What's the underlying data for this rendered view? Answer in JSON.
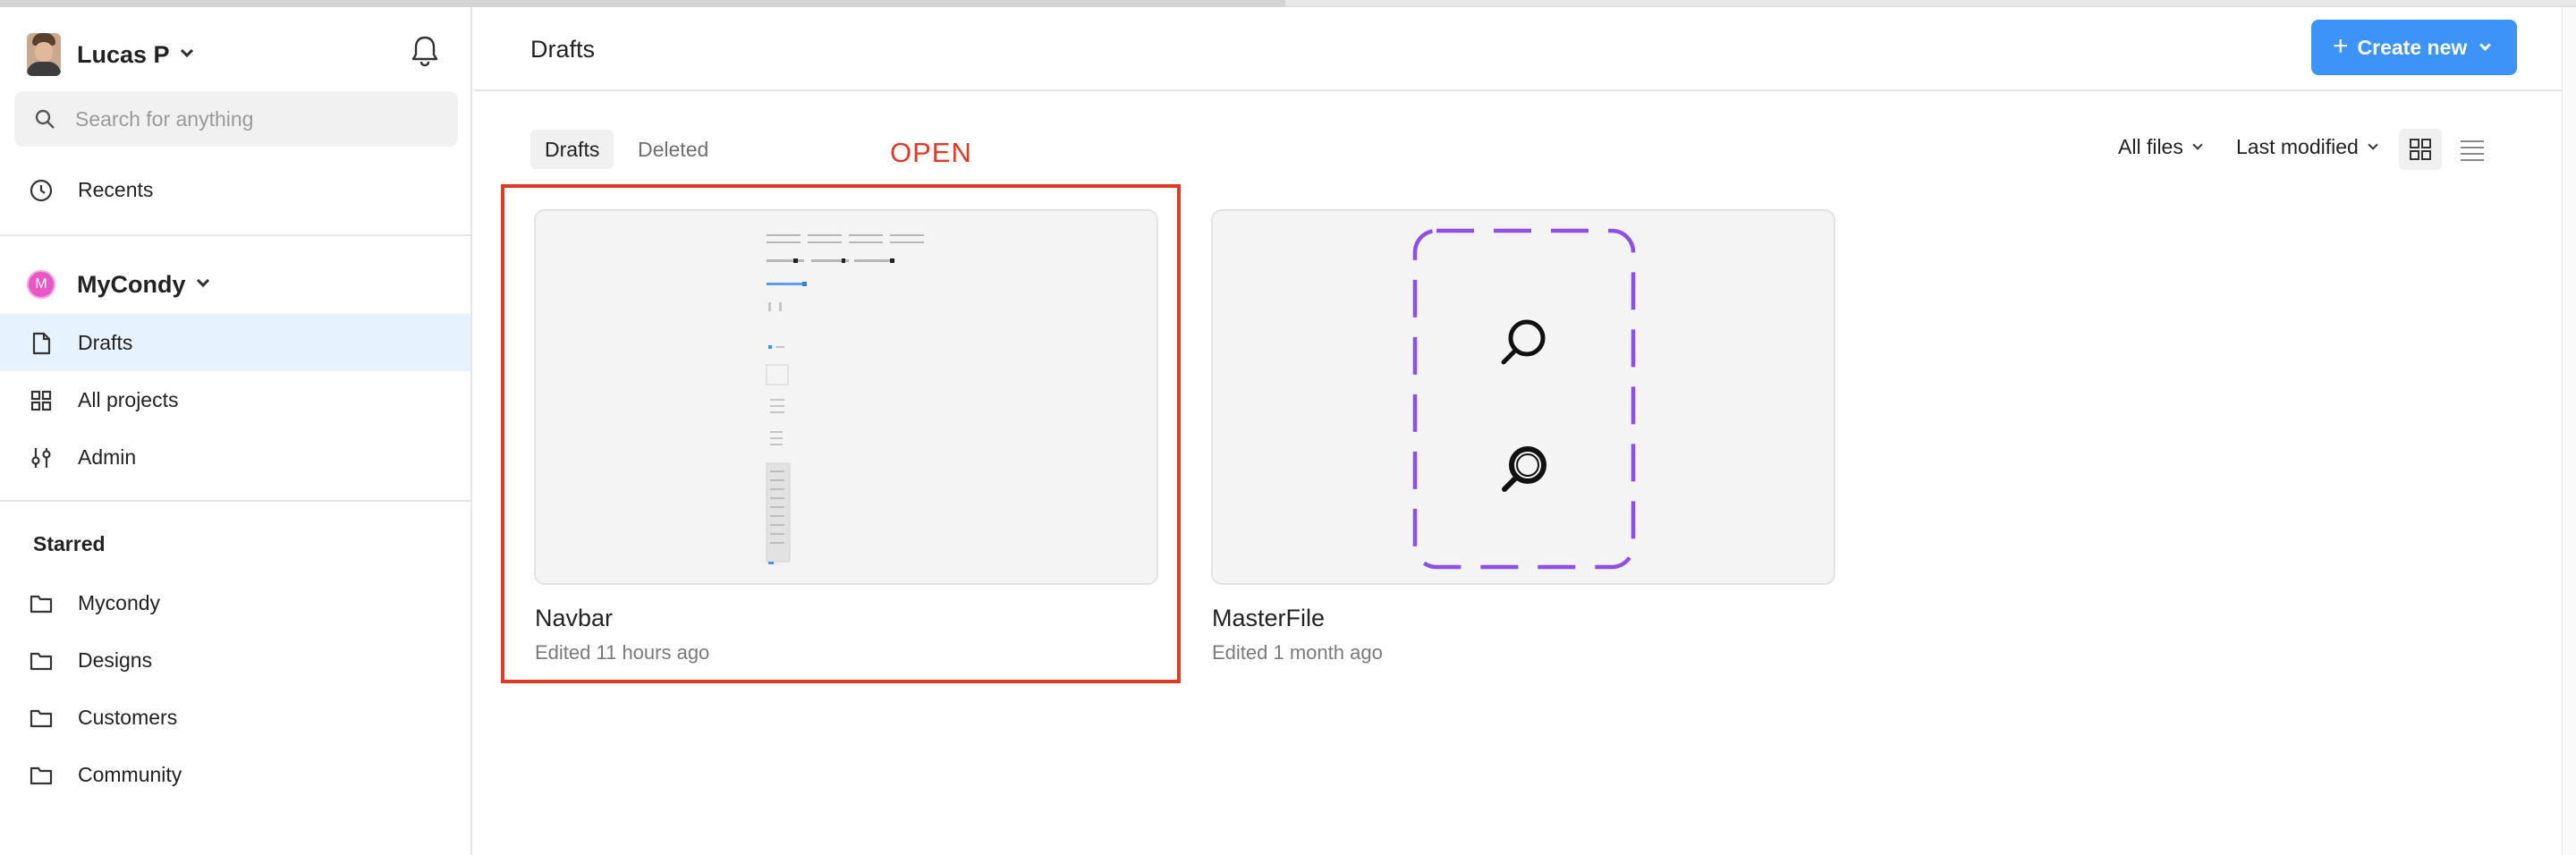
{
  "user": {
    "name": "Lucas P"
  },
  "search": {
    "placeholder": "Search for anything"
  },
  "nav": {
    "recents": "Recents",
    "team": {
      "initial": "M",
      "name": "MyCondy"
    },
    "drafts": "Drafts",
    "all_projects": "All projects",
    "admin": "Admin"
  },
  "starred": {
    "title": "Starred",
    "items": [
      "Mycondy",
      "Designs",
      "Customers",
      "Community"
    ]
  },
  "header": {
    "title": "Drafts",
    "create_label": "Create new",
    "create_plus": "+"
  },
  "tabs": [
    "Drafts",
    "Deleted"
  ],
  "filters": {
    "files": "All files",
    "sort": "Last modified"
  },
  "annotation": {
    "label": "OPEN"
  },
  "files": [
    {
      "name": "Navbar",
      "meta": "Edited 11 hours ago"
    },
    {
      "name": "MasterFile",
      "meta": "Edited 1 month ago"
    }
  ],
  "colors": {
    "accent": "#3d93f8",
    "annotation": "#e03a24",
    "active_nav": "#e6f2fd",
    "team_badge": "#e957c4",
    "placeholder_dash": "#8e4fe8"
  }
}
